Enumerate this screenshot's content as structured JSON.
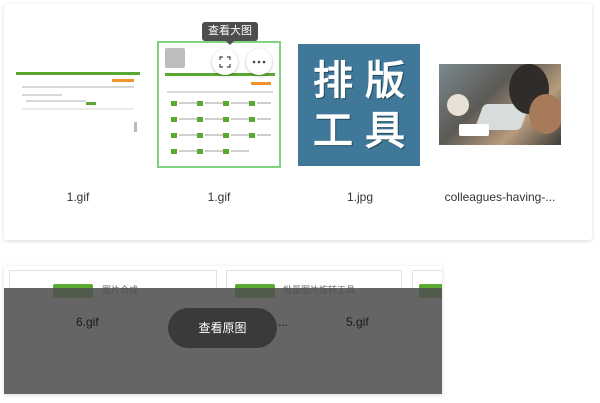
{
  "gallery": {
    "tooltip": "查看大图",
    "items": [
      {
        "name": "1.gif",
        "kind": "screenshot"
      },
      {
        "name": "1.gif",
        "kind": "screenshot-grid",
        "selected": true
      },
      {
        "name": "1.jpg",
        "kind": "typography",
        "chars": [
          "排",
          "版",
          "工",
          "具"
        ]
      },
      {
        "name": "colleagues-having-...",
        "kind": "photo"
      }
    ],
    "actions": {
      "fullscreen_icon": "expand-icon",
      "more_icon": "more-icon"
    }
  },
  "lower": {
    "cards": [
      {
        "title": "图片合成"
      },
      {
        "title": "批量图片旋转工具"
      }
    ],
    "overlay_labels": [
      "6.gif",
      "...",
      "5.gif"
    ],
    "view_original": "查看原图"
  },
  "colors": {
    "accent_green": "#5aa832",
    "selected_border": "#7ed37c",
    "typo_bg": "#3f7898",
    "overlay": "#505050"
  }
}
